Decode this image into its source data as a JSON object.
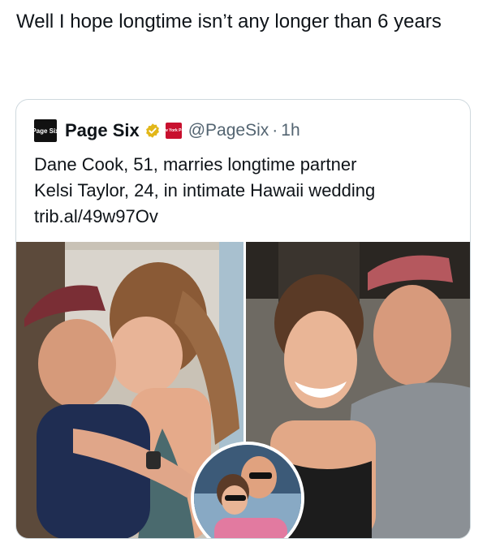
{
  "caption": {
    "text": "Well I hope longtime isn’t any longer than 6 years"
  },
  "quote": {
    "logo_text": "Page Six",
    "display_name": "Page Six",
    "affiliate_badge_text": "New York Post",
    "handle": "@PageSix",
    "separator": "·",
    "time": "1h",
    "text_lines": [
      "Dane Cook, 51, marries longtime partner",
      "Kelsi Taylor, 24, in intimate Hawaii wedding",
      "trib.al/49w97Ov"
    ]
  },
  "icons": {
    "verified": "verified-badge-icon",
    "affiliate": "affiliate-badge-icon"
  },
  "colors": {
    "text": "#0f1419",
    "secondary": "#536471",
    "border": "#cfd9de",
    "verified_gold": "#e2b719",
    "affiliate_red": "#c8102e"
  }
}
